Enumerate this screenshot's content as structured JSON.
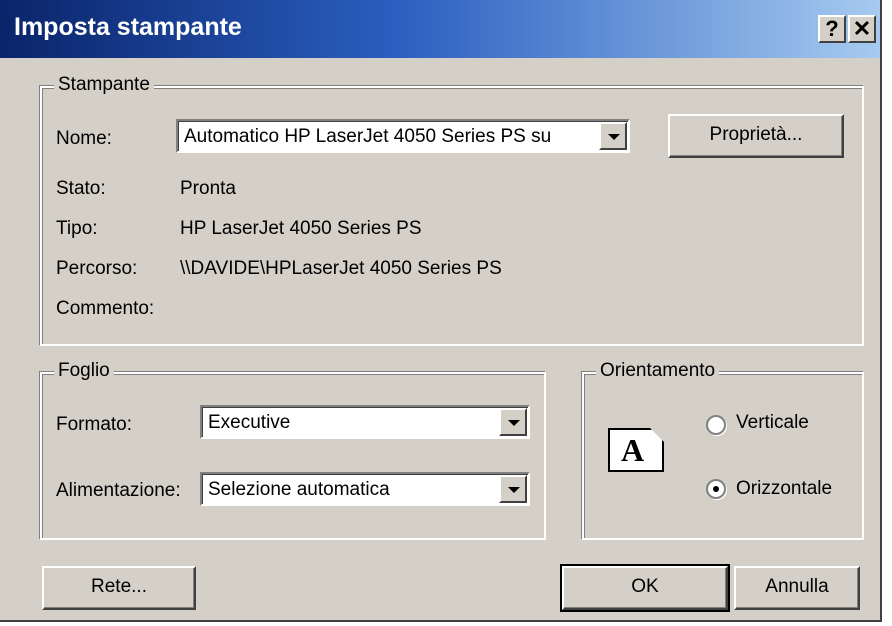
{
  "window": {
    "title": "Imposta stampante",
    "help_button": "?",
    "close_button": "✕"
  },
  "printer": {
    "group_label": "Stampante",
    "name_label": "Nome:",
    "name_value": "Automatico HP LaserJet 4050 Series PS su",
    "properties_button": "Proprietà...",
    "status_label": "Stato:",
    "status_value": "Pronta",
    "type_label": "Tipo:",
    "type_value": "HP LaserJet 4050 Series PS",
    "path_label": "Percorso:",
    "path_value": "\\\\DAVIDE\\HPLaserJet 4050 Series PS",
    "comment_label": "Commento:"
  },
  "paper": {
    "group_label": "Foglio",
    "size_label": "Formato:",
    "size_value": "Executive",
    "source_label": "Alimentazione:",
    "source_value": "Selezione automatica"
  },
  "orientation": {
    "group_label": "Orientamento",
    "icon_letter": "A",
    "portrait_label": "Verticale",
    "landscape_label": "Orizzontale",
    "selected": "Orizzontale"
  },
  "buttons": {
    "network": "Rete...",
    "ok": "OK",
    "cancel": "Annulla"
  }
}
